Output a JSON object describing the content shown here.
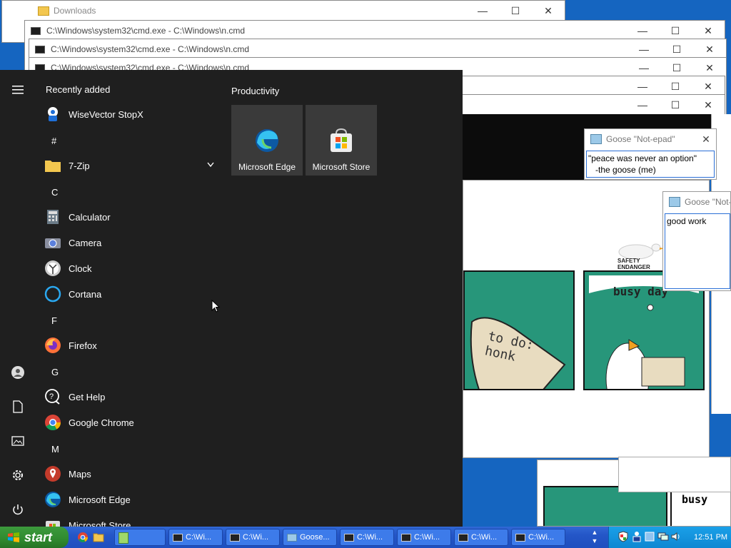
{
  "downloads_window": {
    "title": "Downloads"
  },
  "cmd_windows": [
    {
      "title": "C:\\Windows\\system32\\cmd.exe - C:\\Windows\\n.cmd"
    },
    {
      "title": "C:\\Windows\\system32\\cmd.exe - C:\\Windows\\n.cmd"
    },
    {
      "title": "C:\\Windows\\system32\\cmd.exe - C:\\Windows\\n.cmd"
    }
  ],
  "goose_note_1": {
    "title": "Goose \"Not-epad\"",
    "text": "\"peace was never an option\"\n   -the goose (me)"
  },
  "goose_note_2": {
    "title": "Goose \"Not-",
    "text": "good work"
  },
  "meme": {
    "panel1_text": "to do:\nhonk",
    "panel2_title": "busy day",
    "panel3_title": "busy",
    "banner": "SAFETY ENDANGER"
  },
  "start_menu": {
    "recent_header": "Recently added",
    "recent_app": "WiseVector StopX",
    "groups": [
      {
        "letter": "#",
        "apps": [
          "7-Zip"
        ]
      },
      {
        "letter": "C",
        "apps": [
          "Calculator",
          "Camera",
          "Clock",
          "Cortana"
        ]
      },
      {
        "letter": "F",
        "apps": [
          "Firefox"
        ]
      },
      {
        "letter": "G",
        "apps": [
          "Get Help",
          "Google Chrome"
        ]
      },
      {
        "letter": "M",
        "apps": [
          "Maps",
          "Microsoft Edge",
          "Microsoft Store"
        ]
      }
    ],
    "tiles_header": "Productivity",
    "tiles": [
      "Microsoft Edge",
      "Microsoft Store"
    ]
  },
  "taskbar": {
    "start_label": "start",
    "buttons": [
      "C:\\Wi...",
      "C:\\Wi...",
      "Goose...",
      "C:\\Wi...",
      "C:\\Wi...",
      "C:\\Wi...",
      "C:\\Wi..."
    ],
    "clock": "12:51 PM"
  },
  "colors": {
    "taskbar_blue": "#245edb",
    "start_green": "#3c9a3c",
    "start_menu_bg": "#1f1f1f",
    "tile_bg": "#3a3a3a",
    "meme_green": "#27967a"
  }
}
